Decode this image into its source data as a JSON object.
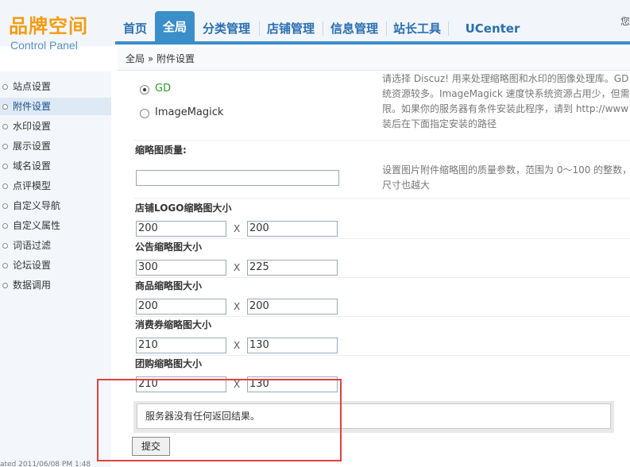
{
  "brand": {
    "name_cn": "品牌空间",
    "name_en": "Control Panel"
  },
  "nav": {
    "tabs": [
      "首页",
      "全局",
      "分类管理",
      "店铺管理",
      "信息管理",
      "站长工具",
      "UCenter"
    ],
    "active_index": 1,
    "corner_text": "您"
  },
  "breadcrumb": "全局 » 附件设置",
  "sidebar": {
    "items": [
      "站点设置",
      "附件设置",
      "水印设置",
      "展示设置",
      "域名设置",
      "点评模型",
      "自定义导航",
      "自定义属性",
      "词语过滤",
      "论坛设置",
      "数据调用"
    ],
    "active_index": 1,
    "bottom_text": "ated 2011/06/08 PM 1:48"
  },
  "image_lib": {
    "options": [
      "GD",
      "ImageMagick"
    ],
    "selected_index": 0,
    "help_lines": [
      "请选择 Discuz! 用来处理缩略图和水印的图像处理库。GD",
      "统资源较多。ImageMagick 速度快系统资源占用少，但需",
      "限。如果你的服务器有条件安装此程序，请到 http://www",
      "装后在下面指定安装的路径"
    ]
  },
  "thumb_quality": {
    "label": "缩略图质量:",
    "value": "",
    "help_lines": [
      "设置图片附件缩略图的质量参数，范围为 0～100 的整数，",
      "尺寸也越大"
    ]
  },
  "size_fields": [
    {
      "label": "店铺LOGO缩略图大小",
      "width": "200",
      "height": "200"
    },
    {
      "label": "公告缩略图大小",
      "width": "300",
      "height": "225"
    },
    {
      "label": "商品缩略图大小",
      "width": "200",
      "height": "200"
    },
    {
      "label": "消费券缩略图大小",
      "width": "210",
      "height": "130"
    },
    {
      "label": "团购缩略图大小",
      "width": "210",
      "height": "130"
    }
  ],
  "x_symbol": "X",
  "result_message": "服务器没有任何返回结果。",
  "submit_label": "提交",
  "colors": {
    "accent": "#3a8ec9",
    "brand_orange": "#f39c12",
    "highlight": "#e0413c",
    "selected_option": "#2e9a2e"
  }
}
